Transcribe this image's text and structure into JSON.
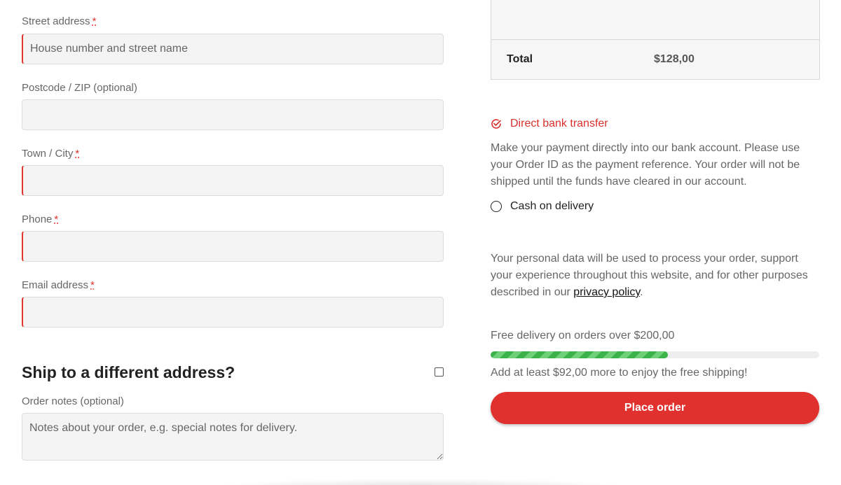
{
  "form": {
    "street": {
      "label": "Street address",
      "required_mark": "*",
      "placeholder": "House number and street name"
    },
    "postcode": {
      "label": "Postcode / ZIP (optional)",
      "placeholder": ""
    },
    "town": {
      "label": "Town / City",
      "required_mark": "*",
      "placeholder": ""
    },
    "phone": {
      "label": "Phone",
      "required_mark": "*",
      "placeholder": ""
    },
    "email": {
      "label": "Email address",
      "required_mark": "*",
      "placeholder": ""
    },
    "ship_different": {
      "heading": "Ship to a different address?",
      "checked": false
    },
    "order_notes": {
      "label": "Order notes (optional)",
      "placeholder": "Notes about your order, e.g. special notes for delivery."
    }
  },
  "summary": {
    "total_label": "Total",
    "total_value": "$128,00"
  },
  "payment": {
    "bank": {
      "label": "Direct bank transfer",
      "selected": true,
      "description": "Make your payment directly into our bank account. Please use your Order ID as the payment reference. Your order will not be shipped until the funds have cleared in our account."
    },
    "cod": {
      "label": "Cash on delivery",
      "selected": false
    }
  },
  "privacy": {
    "text_before": "Your personal data will be used to process your order, support your experience throughout this website, and for other purposes described in our ",
    "link": "privacy policy",
    "text_after": "."
  },
  "free_shipping": {
    "label": "Free delivery on orders over $200,00",
    "progress_percent": 54,
    "message": "Add at least $92,00 more to enjoy the free shipping!"
  },
  "place_order_label": "Place order",
  "colors": {
    "accent": "#e0312f",
    "progress": "#3cb24a"
  }
}
